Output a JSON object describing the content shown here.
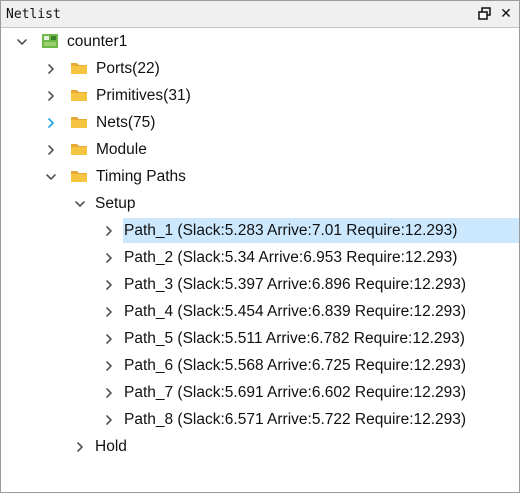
{
  "panel": {
    "title": "Netlist",
    "restore_glyph": "🗗",
    "close_glyph": "✕"
  },
  "tree": {
    "root": {
      "label": "counter1",
      "icon": "design-chip-icon",
      "expanded": true
    },
    "folders": [
      {
        "label": "Ports(22)",
        "expanded": false
      },
      {
        "label": "Primitives(31)",
        "expanded": false
      },
      {
        "label": "Nets(75)",
        "expanded": false,
        "hover": true
      },
      {
        "label": "Module",
        "expanded": false
      },
      {
        "label": "Timing Paths",
        "expanded": true
      }
    ],
    "setup": {
      "label": "Setup",
      "expanded": true
    },
    "paths": [
      {
        "label": "Path_1 (Slack:5.283 Arrive:7.01 Require:12.293)",
        "selected": true
      },
      {
        "label": "Path_2 (Slack:5.34 Arrive:6.953 Require:12.293)"
      },
      {
        "label": "Path_3 (Slack:5.397 Arrive:6.896 Require:12.293)"
      },
      {
        "label": "Path_4 (Slack:5.454 Arrive:6.839 Require:12.293)"
      },
      {
        "label": "Path_5 (Slack:5.511 Arrive:6.782 Require:12.293)"
      },
      {
        "label": "Path_6 (Slack:5.568 Arrive:6.725 Require:12.293)"
      },
      {
        "label": "Path_7 (Slack:5.691 Arrive:6.602 Require:12.293)"
      },
      {
        "label": "Path_8 (Slack:6.571 Arrive:5.722 Require:12.293)"
      }
    ],
    "hold": {
      "label": "Hold",
      "expanded": false
    }
  },
  "colors": {
    "selection": "#cce8ff",
    "folder": "#f5c542",
    "chevron": "#555555",
    "chevron_hover": "#1ba1e2"
  }
}
